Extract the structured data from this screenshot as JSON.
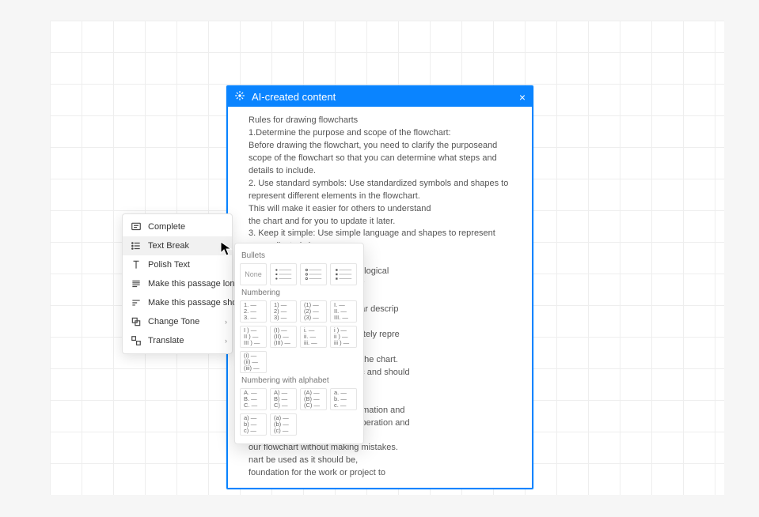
{
  "panel": {
    "title": "AI-created content",
    "body": "Rules for drawing flowcharts\n1.Determine the purpose and scope of the flowchart:\nBefore drawing the flowchart, you need to clarify the purposeand scope of the flowchart so that you can determine what steps and details to include.\n2. Use standard symbols: Use standardized symbols and shapes to represent different elements in the flowchart.\nThis will make it easier for others to understand\nthe chart and for you to update it later.\n3. Keep it simple: Use simple language and shapes to represent\n                                                 y complicated shapes\n                                                 nfusion.\n                                                 s and connectors to show the logical\n                                                  to ensure that the steps follow\n\n                                                 step in the process with a clear descrip\n                                                 stage.\n                                                 vchart to ensure that it accurately repre\n\n                                                 iew and provide feedback on the chart.\n                                                 er that flowcharts are dynamic and should\n                                                 nges or evolves over time.\n\n                                                 w chart needs constant confirmation and\n                                                 clearly express the process operation and\n                                                 arious links,\n                                                 our flowchart without making mistakes.\n                                                 nart be used as it should be,\n                                                 foundation for the work or project to"
  },
  "ctx": {
    "items": [
      {
        "label": "Complete",
        "caret": false
      },
      {
        "label": "Text Break",
        "caret": true
      },
      {
        "label": "Polish Text",
        "caret": false
      },
      {
        "label": "Make this passage longer",
        "caret": false
      },
      {
        "label": "Make this passage shorter",
        "caret": false
      },
      {
        "label": "Change Tone",
        "caret": true
      },
      {
        "label": "Translate",
        "caret": true
      }
    ]
  },
  "sub": {
    "bullets_title": "Bullets",
    "numbering_title": "Numbering",
    "alpha_title": "Numbering with alphabet",
    "none_label": "None",
    "numbering_rows": [
      [
        [
          "1.",
          "2.",
          "3."
        ],
        [
          "1)",
          "2)",
          "3)"
        ],
        [
          "(1)",
          "(2)",
          "(3)"
        ],
        [
          "I.",
          "II.",
          "III."
        ]
      ],
      [
        [
          "I )",
          "II )",
          "III )"
        ],
        [
          "(I)",
          "(II)",
          "(III)"
        ],
        [
          "i.",
          "ii.",
          "iii."
        ],
        [
          "i )",
          "ii )",
          "iii )"
        ]
      ],
      [
        [
          "(i)",
          "(ii)",
          "(iii)"
        ]
      ]
    ],
    "alpha_rows": [
      [
        [
          "A.",
          "B.",
          "C."
        ],
        [
          "A)",
          "B)",
          "C)"
        ],
        [
          "(A)",
          "(B)",
          "(C)"
        ],
        [
          "a.",
          "b.",
          "c."
        ]
      ],
      [
        [
          "a)",
          "b)",
          "c)"
        ],
        [
          "(a)",
          "(b)",
          "(c)"
        ]
      ]
    ]
  }
}
